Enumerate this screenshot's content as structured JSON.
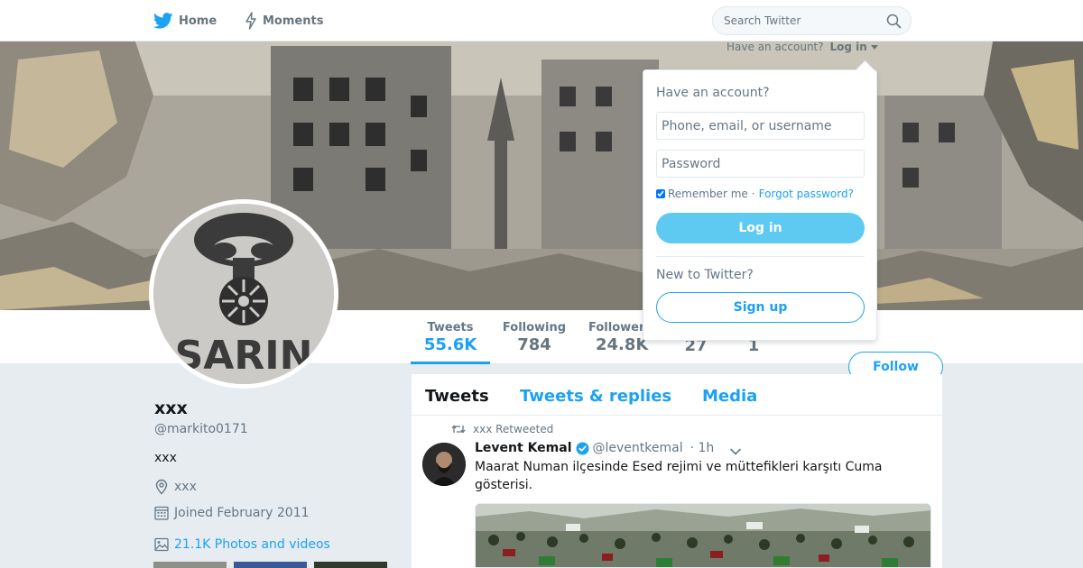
{
  "nav": {
    "home_label": "Home",
    "home_icon": "twitter-bird-icon",
    "moments_label": "Moments",
    "moments_icon": "lightning-icon",
    "search_placeholder": "Search Twitter",
    "search_icon": "search-icon"
  },
  "login_prompt": {
    "text": "Have an account?",
    "link": "Log in"
  },
  "login_dropdown": {
    "title": "Have an account?",
    "username_placeholder": "Phone, email, or username",
    "password_placeholder": "Password",
    "remember_label": "Remember me",
    "separator": "·",
    "forgot_link": "Forgot password?",
    "remember_checked": true,
    "login_button": "Log in",
    "new_label": "New to Twitter?",
    "signup_button": "Sign up"
  },
  "stats": [
    {
      "label": "Tweets",
      "value": "55.6K"
    },
    {
      "label": "Following",
      "value": "784"
    },
    {
      "label": "Follower",
      "value": "24.8K"
    },
    {
      "label": "",
      "value": "27"
    },
    {
      "label": "",
      "value": "1"
    }
  ],
  "follow_button": "Follow",
  "profile": {
    "name": "xxx",
    "handle": "@markito0171",
    "bio": "xxx",
    "location": "xxx",
    "joined": "Joined February 2011",
    "photos_link": "21.1K Photos and videos",
    "avatar_text": "SARIN"
  },
  "timeline": {
    "tabs": [
      "Tweets",
      "Tweets & replies",
      "Media"
    ],
    "retweet_note": "xxx Retweeted",
    "tweet": {
      "author_name": "Levent Kemal",
      "author_handle": "@leventkemal",
      "separator": "·",
      "time": "1h",
      "text": "Maarat Numan ilçesinde Esed rejimi ve müttefikleri karşıtı Cuma gösterisi."
    }
  },
  "colors": {
    "accent": "#1da1f2",
    "background": "#e6ecf0",
    "login_button": "#5ecaf2"
  }
}
